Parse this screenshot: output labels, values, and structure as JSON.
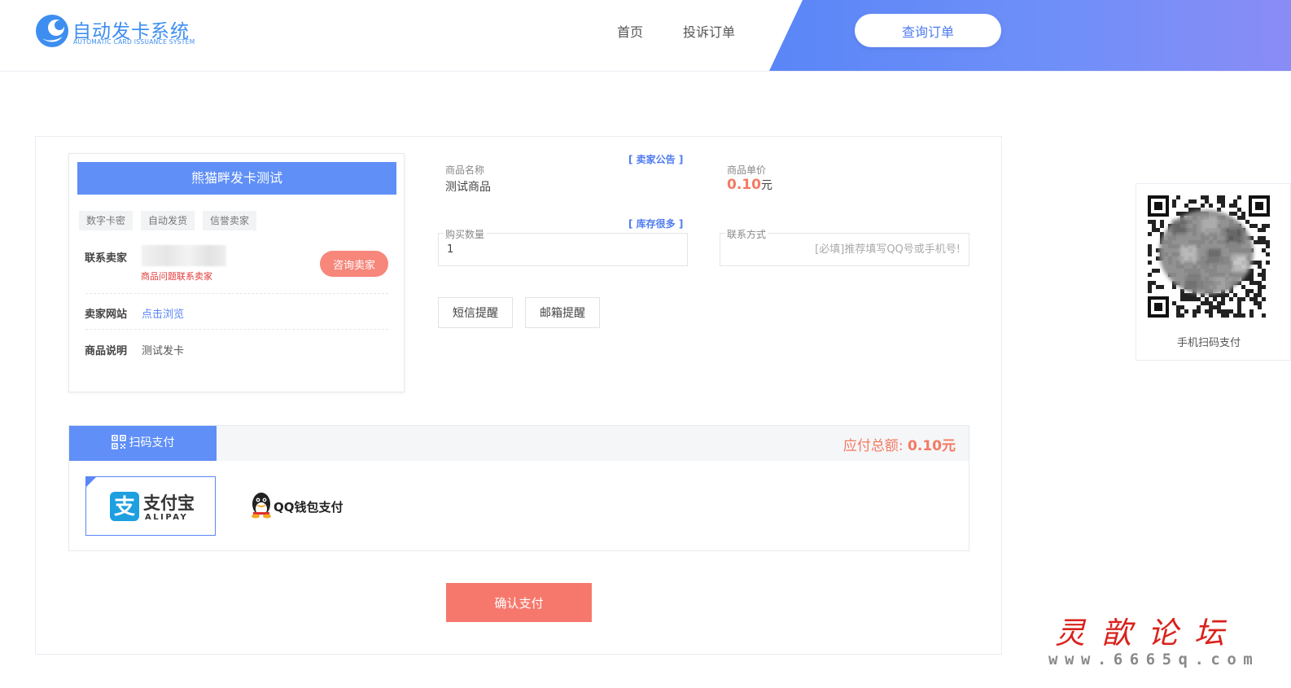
{
  "header": {
    "logo_title": "自动发卡系统",
    "logo_subtitle": "AUTOMATIC CARD ISSUANCE SYSTEM",
    "nav": [
      "首页",
      "投诉订单"
    ],
    "query_button": "查询订单",
    "accent": "#5a86f7"
  },
  "shop": {
    "name": "熊猫畔发卡测试",
    "tags": [
      "数字卡密",
      "自动发货",
      "信誉卖家"
    ],
    "contact_label": "联系卖家",
    "contact_note": "商品问题联系卖家",
    "consult_button": "咨询卖家",
    "website_label": "卖家网站",
    "website_link": "点击浏览",
    "desc_label": "商品说明",
    "desc_value": "测试发卡"
  },
  "product": {
    "notice_link": "[ 卖家公告 ]",
    "name_label": "商品名称",
    "name_value": "测试商品",
    "price_label": "商品单价",
    "price_value": "0.10",
    "price_unit": "元",
    "stock_link": "[ 库存很多 ]",
    "qty_label": "购买数量",
    "qty_value": "1",
    "contact_label": "联系方式",
    "contact_placeholder": "[必填]推荐填写QQ号或手机号!",
    "sms_button": "短信提醒",
    "email_button": "邮箱提醒"
  },
  "payment": {
    "tab_label": "扫码支付",
    "total_label": "应付总额:",
    "total_value": "0.10元",
    "alipay_cn": "支付宝",
    "alipay_en": "ALIPAY",
    "qq_label": "QQ钱包支付",
    "confirm_button": "确认支付"
  },
  "qr": {
    "caption": "手机扫码支付"
  },
  "watermark": {
    "title": "灵歆论坛",
    "url": "www.6665q.com"
  }
}
